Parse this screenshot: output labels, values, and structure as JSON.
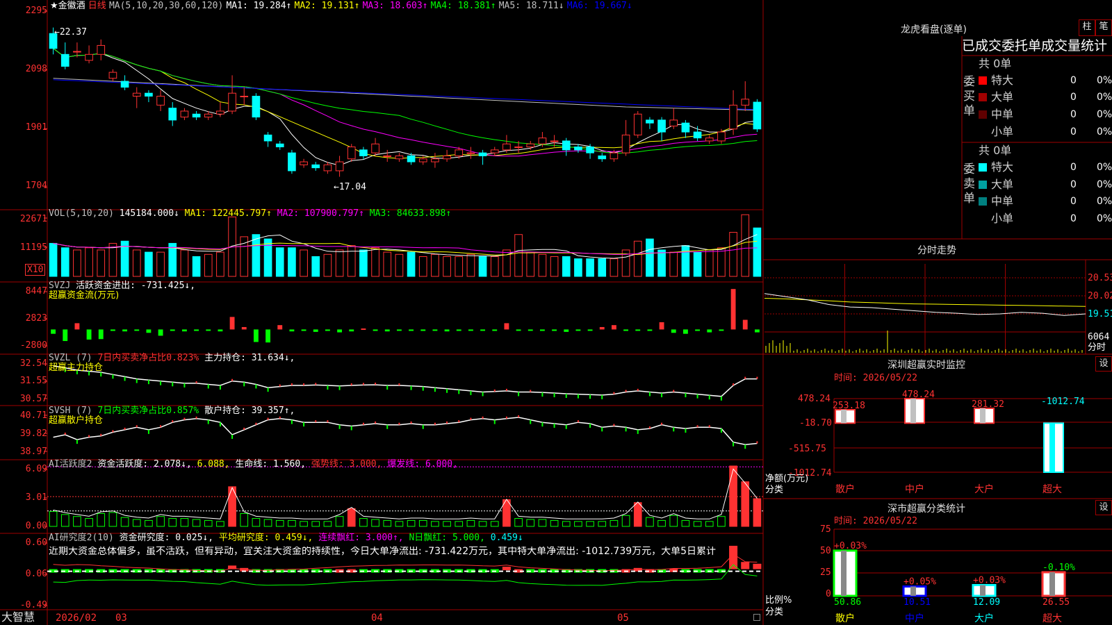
{
  "colors": {
    "up": "#ff3232",
    "down": "#00ffff",
    "grid": "#a00000",
    "ma1": "#ffffff",
    "ma2": "#ffff00",
    "ma3": "#ff00ff",
    "ma4": "#00ff00",
    "ma5": "#c0c0c0",
    "ma6": "#0000ff",
    "green": "#00ff00"
  },
  "header": {
    "stock_name": "★金徽酒",
    "period": "日线",
    "ma_label": "MA(5,10,20,30,60,120)",
    "ma1": "MA1: 19.284↑",
    "ma2": "MA2: 19.131↑",
    "ma3": "MA3: 18.603↑",
    "ma4": "MA4: 18.381↑",
    "ma5": "MA5: 18.711↓",
    "ma6": "MA6: 19.667↓"
  },
  "price_axis": [
    "2295",
    "2098",
    "1901",
    "1704"
  ],
  "price_marks": {
    "high": "←22.37",
    "low": "←17.04"
  },
  "vol": {
    "title": "VOL(5,10,20)",
    "value": "145184.000↓",
    "ma1": "MA1: 122445.797↑",
    "ma2": "MA2: 107900.797↑",
    "ma3": "MA3: 84633.898↑",
    "axis": [
      "22671",
      "11195"
    ],
    "unit": "X10"
  },
  "svzj": {
    "title": "SVZJ",
    "desc": "活跃资金进出: -731.425↓,",
    "sub": "超赢资金流(万元)",
    "axis": [
      "8447",
      "2823",
      "-2800"
    ]
  },
  "svzl": {
    "title": "SVZL (7)",
    "desc1": "7日内买卖净占比0.823%",
    "desc2": "主力持仓: 31.634↓,",
    "sub": "超赢主力持仓",
    "axis": [
      "32.54",
      "31.55",
      "30.57"
    ]
  },
  "svsh": {
    "title": "SVSH (7)",
    "desc1": "7日内买卖净占比0.857%",
    "desc2": "散户持仓: 39.357↑,",
    "sub": "超赢散户持仓",
    "axis": [
      "40.71",
      "39.82",
      "38.97"
    ]
  },
  "ai1": {
    "title": "AI活跃度2",
    "desc1": "资金活跃度: 2.078↓,",
    "desc1b": "6.088,",
    "desc2": "生命线: 1.560,",
    "desc3": "强势线: 3.000,",
    "desc4": "爆发线: 6.000,",
    "axis": [
      "6.09",
      "3.01",
      "0.00"
    ]
  },
  "ai2": {
    "title": "AI研究度2(10)",
    "desc1": "资金研究度: 0.025↓,",
    "desc2": "平均研究度: 0.459↓,",
    "desc3": "连续飘红: 3.000↑,",
    "desc4": "N日飘红: 5.000,",
    "desc5": "0.459↓",
    "comment": "近期大资金总体偏多，虽不活跃，但有异动，宜关注大资金的持续性，今日大单净流出: -731.422万元，其中特大单净流出: -1012.739万元，大单5日累计",
    "axis": [
      "0.60",
      "0.06",
      "-0.49"
    ]
  },
  "footer": {
    "brand": "大智慧",
    "date_start": "2026/02",
    "m03": "03",
    "m04": "04",
    "m05": "05"
  },
  "lhb": {
    "title": "龙虎看盘(逐单)",
    "btn1": "柱",
    "btn2": "笔",
    "tabs": "已成交委托单成交量统计",
    "buy_label": "委买单",
    "sell_label": "委卖单",
    "buy_total": "共 0单",
    "sell_total": "共 0单",
    "buy_rows": [
      {
        "name": "特大",
        "count": "0",
        "pct": "0%",
        "color": "#ff0000"
      },
      {
        "name": "大单",
        "count": "0",
        "pct": "0%",
        "color": "#a00000"
      },
      {
        "name": "中单",
        "count": "0",
        "pct": "0%",
        "color": "#600000"
      },
      {
        "name": "小单",
        "count": "0",
        "pct": "0%",
        "color": "#000000"
      }
    ],
    "sell_rows": [
      {
        "name": "特大",
        "count": "0",
        "pct": "0%",
        "color": "#00ffff"
      },
      {
        "name": "大单",
        "count": "0",
        "pct": "0%",
        "color": "#00a0a0"
      },
      {
        "name": "中单",
        "count": "0",
        "pct": "0%",
        "color": "#008080"
      },
      {
        "name": "小单",
        "count": "0",
        "pct": "0%",
        "color": "#000000"
      }
    ]
  },
  "fenshi": {
    "title": "分时走势",
    "axis": [
      "20.53",
      "20.02",
      "19.51",
      "6064"
    ],
    "unit": "分时"
  },
  "monitor": {
    "title": "深圳超赢实时监控",
    "btn": "设",
    "time": "时间: 2026/05/22",
    "axis": [
      "478.24",
      "-18.70",
      "-515.75",
      "-1012.74"
    ],
    "ylabel1": "净额(万元)",
    "ylabel2": "分类",
    "cats": [
      "散户",
      "中户",
      "大户",
      "超大"
    ]
  },
  "classify": {
    "title": "深市超赢分类统计",
    "btn": "设",
    "time": "时间: 2026/05/22",
    "axis": [
      "75",
      "50",
      "25",
      "0"
    ],
    "ylabel1": "比例%",
    "ylabel2": "分类",
    "cats": [
      "散户",
      "中户",
      "大户",
      "超大"
    ]
  },
  "chart_data": [
    {
      "type": "candlestick",
      "name": "daily-kline",
      "ylim": [
        17.04,
        22.95
      ],
      "ticks": [
        22.95,
        20.98,
        19.01,
        17.04
      ],
      "candles": [
        [
          22.2,
          21.7,
          22.4,
          21.5
        ],
        [
          21.5,
          21.1,
          21.9,
          21.0
        ],
        [
          21.6,
          21.6,
          21.9,
          21.4
        ],
        [
          21.3,
          21.5,
          21.8,
          21.2
        ],
        [
          21.5,
          21.8,
          22.0,
          21.3
        ],
        [
          20.7,
          20.9,
          21.0,
          20.6
        ],
        [
          20.6,
          20.4,
          20.8,
          20.3
        ],
        [
          20.1,
          20.2,
          20.4,
          19.7
        ],
        [
          20.2,
          20.1,
          20.3,
          19.9
        ],
        [
          19.8,
          20.1,
          20.3,
          19.6
        ],
        [
          19.7,
          19.3,
          19.9,
          19.1
        ],
        [
          19.4,
          19.6,
          19.7,
          19.3
        ],
        [
          19.5,
          19.4,
          19.6,
          19.3
        ],
        [
          19.4,
          19.5,
          19.6,
          19.3
        ],
        [
          19.5,
          19.6,
          19.9,
          19.4
        ],
        [
          19.6,
          20.2,
          20.8,
          19.5
        ],
        [
          20.1,
          20.1,
          20.4,
          19.8
        ],
        [
          20.1,
          19.4,
          20.2,
          19.3
        ],
        [
          18.8,
          18.6,
          18.9,
          18.4
        ],
        [
          18.5,
          18.4,
          18.6,
          18.3
        ],
        [
          18.2,
          17.6,
          18.3,
          17.5
        ],
        [
          17.8,
          17.9,
          18.0,
          17.7
        ],
        [
          17.8,
          17.7,
          17.9,
          17.6
        ],
        [
          17.6,
          17.8,
          17.9,
          17.5
        ],
        [
          17.6,
          17.9,
          18.1,
          17.4
        ],
        [
          18.0,
          18.4,
          18.5,
          17.9
        ],
        [
          18.3,
          18.1,
          18.4,
          18.0
        ],
        [
          18.2,
          18.5,
          18.7,
          18.1
        ],
        [
          18.1,
          18.1,
          18.3,
          17.9
        ],
        [
          18.0,
          18.1,
          18.2,
          17.9
        ],
        [
          18.1,
          17.9,
          18.2,
          17.8
        ],
        [
          17.9,
          18.0,
          18.1,
          17.8
        ],
        [
          17.9,
          18.0,
          18.2,
          17.7
        ],
        [
          18.0,
          18.1,
          18.3,
          17.9
        ],
        [
          18.1,
          18.3,
          18.4,
          18.0
        ],
        [
          18.2,
          18.2,
          18.4,
          18.0
        ],
        [
          18.2,
          18.1,
          18.3,
          17.8
        ],
        [
          18.2,
          18.3,
          18.4,
          18.1
        ],
        [
          18.3,
          18.5,
          18.8,
          18.2
        ],
        [
          18.4,
          18.4,
          18.6,
          18.2
        ],
        [
          18.4,
          18.5,
          18.6,
          18.3
        ],
        [
          18.5,
          18.7,
          18.9,
          18.4
        ],
        [
          18.6,
          18.6,
          18.8,
          18.4
        ],
        [
          18.6,
          18.3,
          18.7,
          18.1
        ],
        [
          18.4,
          18.3,
          18.5,
          18.2
        ],
        [
          18.4,
          18.2,
          18.5,
          18.0
        ],
        [
          18.1,
          18.0,
          18.2,
          17.9
        ],
        [
          18.0,
          18.2,
          18.3,
          17.9
        ],
        [
          18.2,
          18.8,
          19.3,
          18.1
        ],
        [
          18.8,
          19.5,
          19.6,
          18.7
        ],
        [
          19.3,
          19.2,
          19.4,
          19.0
        ],
        [
          19.3,
          18.9,
          19.4,
          18.6
        ],
        [
          19.1,
          19.3,
          19.7,
          19.0
        ],
        [
          19.2,
          18.9,
          19.3,
          18.7
        ],
        [
          18.9,
          18.7,
          19.1,
          18.6
        ],
        [
          18.6,
          18.7,
          18.8,
          18.5
        ],
        [
          18.6,
          18.9,
          19.0,
          18.5
        ],
        [
          19.0,
          19.8,
          20.3,
          18.8
        ],
        [
          19.8,
          20.0,
          20.6,
          19.6
        ],
        [
          19.9,
          19.0,
          20.0,
          18.9
        ]
      ]
    },
    {
      "type": "bar",
      "name": "volume",
      "ylim": [
        0,
        29000
      ],
      "values": [
        15000,
        13000,
        12000,
        13000,
        12000,
        15000,
        16000,
        12000,
        11000,
        11000,
        15000,
        12000,
        9000,
        10000,
        11000,
        27000,
        18000,
        19000,
        17000,
        13000,
        13000,
        12000,
        9000,
        10000,
        12000,
        14000,
        12000,
        13000,
        11000,
        10000,
        11000,
        9000,
        10000,
        9000,
        9000,
        10000,
        9000,
        9000,
        12000,
        19000,
        11000,
        10000,
        9000,
        9000,
        8000,
        8000,
        8000,
        8000,
        12000,
        16000,
        17000,
        12000,
        11000,
        14000,
        11000,
        12000,
        13000,
        20000,
        28000,
        22000
      ]
    },
    {
      "type": "bar",
      "name": "svzj-capital-flow",
      "ylim": [
        -3400,
        9000
      ],
      "values": [
        -900,
        -2400,
        1300,
        -2100,
        -2000,
        -300,
        -400,
        -200,
        -700,
        -1300,
        -300,
        -400,
        -300,
        -200,
        -400,
        2600,
        500,
        -2600,
        -2700,
        900,
        -400,
        -300,
        -500,
        -300,
        -600,
        -400,
        200,
        -300,
        -400,
        -200,
        -300,
        -300,
        -200,
        -400,
        -300,
        -200,
        -200,
        -300,
        1300,
        -200,
        -200,
        -300,
        -300,
        -500,
        -200,
        -200,
        500,
        900,
        -300,
        -200,
        -300,
        1500,
        -700,
        -900,
        -300,
        -600,
        -200,
        8400,
        2000,
        -600
      ]
    },
    {
      "type": "line",
      "name": "svzl-main-holding",
      "ylim": [
        30.57,
        32.54
      ],
      "values": [
        32.2,
        32.1,
        32.0,
        31.95,
        31.9,
        31.8,
        31.7,
        31.6,
        31.55,
        31.5,
        31.45,
        31.4,
        31.4,
        31.35,
        31.3,
        31.5,
        31.45,
        31.35,
        31.2,
        31.25,
        31.3,
        31.3,
        31.32,
        31.3,
        31.28,
        31.3,
        31.32,
        31.33,
        31.3,
        31.3,
        31.28,
        31.25,
        31.2,
        31.15,
        31.1,
        31.05,
        31.0,
        31.02,
        31.05,
        31.0,
        31.0,
        30.98,
        30.95,
        30.92,
        30.9,
        30.88,
        30.86,
        30.9,
        31.0,
        31.05,
        31.0,
        30.95,
        31.0,
        30.95,
        30.9,
        30.85,
        30.8,
        31.3,
        31.6,
        31.6
      ]
    },
    {
      "type": "line",
      "name": "svsh-retail-holding",
      "ylim": [
        38.97,
        40.71
      ],
      "values": [
        39.6,
        39.7,
        39.5,
        39.6,
        39.65,
        39.8,
        39.9,
        40.0,
        39.9,
        40.0,
        40.2,
        40.3,
        40.35,
        40.3,
        40.2,
        39.7,
        39.9,
        40.1,
        40.3,
        40.35,
        40.3,
        40.2,
        40.2,
        40.2,
        40.1,
        40.05,
        40.1,
        40.15,
        40.1,
        40.1,
        40.15,
        40.1,
        40.1,
        40.15,
        40.2,
        40.3,
        40.35,
        40.3,
        40.35,
        40.4,
        40.3,
        40.2,
        40.15,
        40.1,
        40.2,
        40.15,
        40.0,
        40.05,
        40.0,
        39.9,
        39.95,
        40.1,
        40.0,
        39.95,
        40.0,
        40.0,
        39.95,
        39.4,
        39.3,
        39.35
      ]
    },
    {
      "type": "bar",
      "name": "ai-activity",
      "ylim": [
        0,
        6.3
      ],
      "values": [
        1.5,
        1.2,
        1.0,
        0.8,
        1.3,
        1.4,
        0.9,
        0.7,
        0.6,
        1.0,
        0.8,
        0.8,
        0.7,
        0.6,
        0.5,
        4.0,
        1.3,
        0.8,
        0.7,
        0.6,
        0.6,
        0.5,
        0.5,
        0.5,
        1.0,
        1.8,
        0.8,
        0.7,
        0.6,
        0.5,
        0.6,
        0.6,
        0.5,
        0.5,
        0.5,
        0.6,
        0.5,
        0.5,
        2.7,
        0.8,
        0.7,
        0.7,
        0.6,
        0.5,
        0.5,
        0.5,
        0.5,
        0.6,
        1.1,
        2.4,
        0.9,
        0.6,
        1.1,
        0.6,
        0.5,
        0.5,
        1.0,
        6.09,
        4.5,
        2.8
      ]
    },
    {
      "type": "bar",
      "name": "ai-research",
      "ylim": [
        -0.49,
        0.6
      ],
      "values": [
        0.05,
        0.02,
        0.05,
        0.05,
        0.03,
        0.03,
        0.02,
        0.02,
        0.03,
        0.02,
        0.02,
        0.03,
        0.02,
        0.02,
        0.02,
        0.12,
        0.08,
        0.05,
        0.04,
        0.05,
        0.05,
        0.04,
        0.05,
        0.05,
        0.06,
        0.06,
        0.05,
        0.05,
        0.04,
        0.04,
        0.03,
        0.03,
        0.03,
        0.03,
        0.04,
        0.04,
        0.04,
        0.05,
        0.1,
        0.06,
        0.05,
        0.05,
        0.05,
        0.04,
        0.04,
        0.04,
        0.03,
        0.05,
        0.06,
        0.08,
        0.06,
        0.05,
        0.07,
        0.05,
        0.04,
        0.04,
        0.05,
        0.45,
        0.18,
        0.15
      ]
    },
    {
      "type": "line",
      "name": "intraday",
      "ylim": [
        19.0,
        21.0
      ],
      "ticks": [
        20.53,
        20.02,
        19.51
      ],
      "avg_line": [
        19.9,
        19.88,
        19.85,
        19.82,
        19.78,
        19.76,
        19.74,
        19.72,
        19.71,
        19.7,
        19.69,
        19.68,
        19.67,
        19.66,
        19.65,
        19.64
      ],
      "price_line": [
        20.05,
        19.95,
        19.85,
        19.7,
        19.62,
        19.6,
        19.55,
        19.5,
        19.45,
        19.42,
        19.38,
        19.4,
        19.45,
        19.42,
        19.35,
        19.4
      ]
    },
    {
      "type": "bar",
      "name": "shenzhen-realtime-monitor",
      "categories": [
        "散户",
        "中户",
        "大户",
        "超大"
      ],
      "values": [
        253.18,
        478.24,
        281.32,
        -1012.74
      ],
      "ylim": [
        -1012.74,
        478.24
      ]
    },
    {
      "type": "bar",
      "name": "shenzhen-classify-stat",
      "categories": [
        "散户",
        "中户",
        "大户",
        "超大"
      ],
      "values": [
        50.86,
        10.51,
        12.09,
        26.55
      ],
      "change": [
        "+0.03%",
        "+0.05%",
        "+0.03%",
        "-0.10%"
      ],
      "ylim": [
        0,
        75
      ]
    }
  ]
}
